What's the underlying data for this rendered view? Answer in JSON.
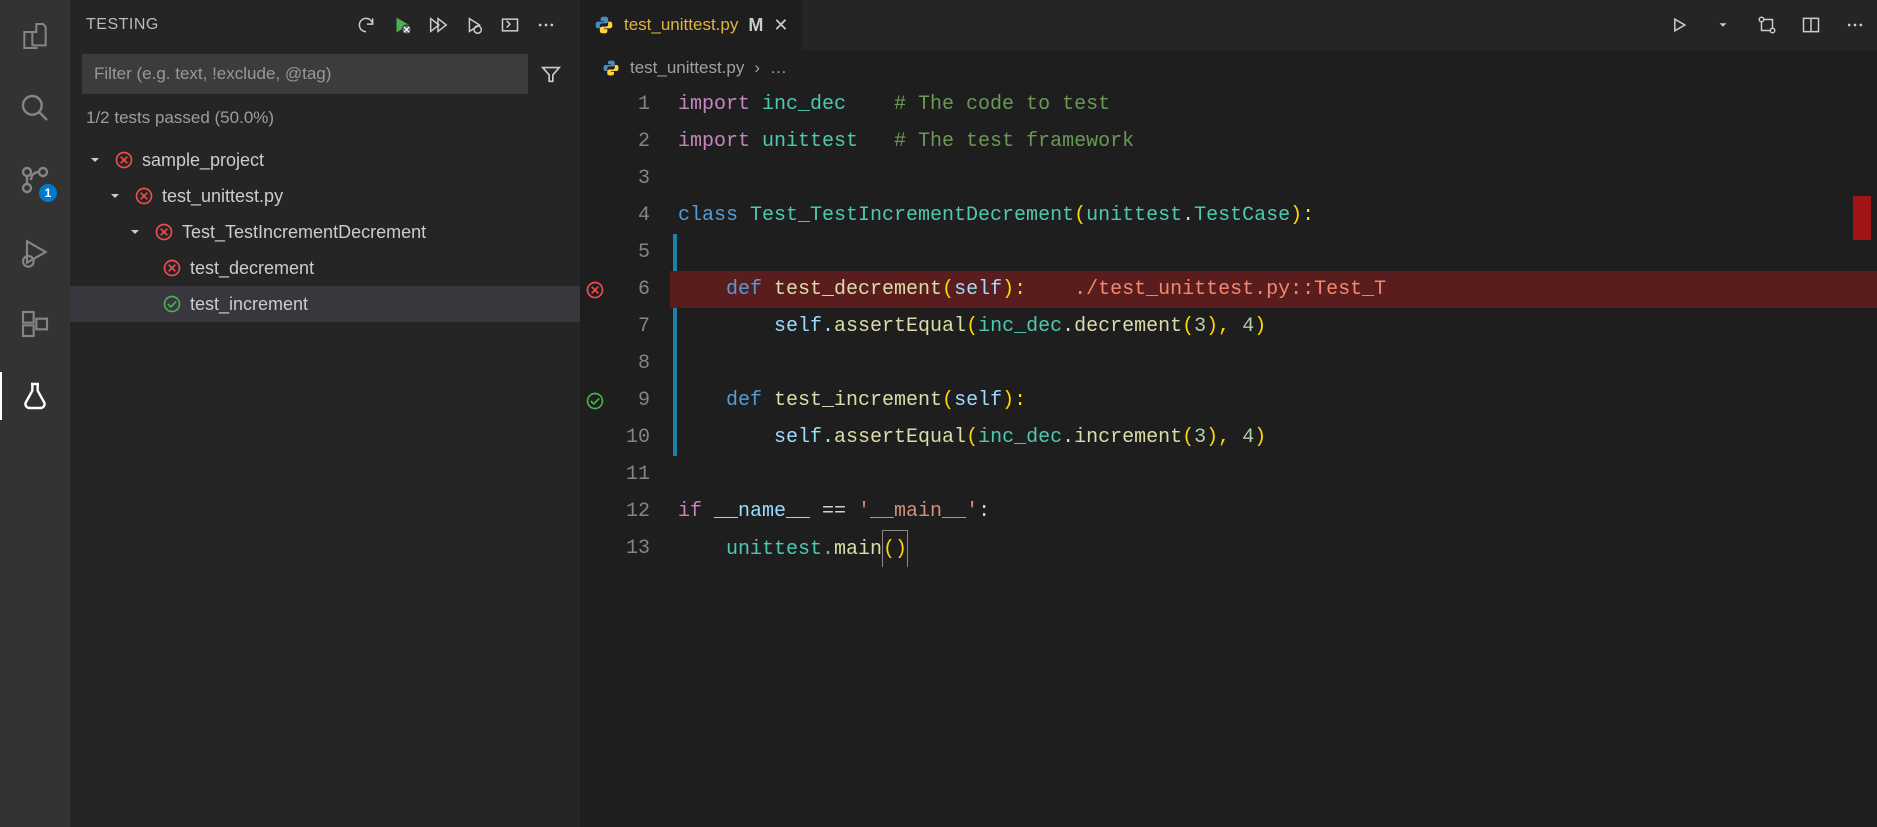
{
  "activitybar": {
    "source_control_badge": "1"
  },
  "sidebar": {
    "title": "TESTING",
    "filter_placeholder": "Filter (e.g. text, !exclude, @tag)",
    "status": "1/2 tests passed (50.0%)"
  },
  "tree": {
    "project": "sample_project",
    "file": "test_unittest.py",
    "class": "Test_TestIncrementDecrement",
    "test_fail": "test_decrement",
    "test_pass": "test_increment"
  },
  "tab": {
    "icon": "python-icon",
    "name": "test_unittest.py",
    "modified": "M"
  },
  "breadcrumb": {
    "file": "test_unittest.py",
    "more": "…"
  },
  "code": {
    "lines": [
      "1",
      "2",
      "3",
      "4",
      "5",
      "6",
      "7",
      "8",
      "9",
      "10",
      "11",
      "12",
      "13"
    ],
    "l1_a": "import ",
    "l1_b": "inc_dec",
    "l1_c": "    # The code to test",
    "l2_a": "import ",
    "l2_b": "unittest",
    "l2_c": "   # The test framework",
    "l4_a": "class ",
    "l4_b": "Test_TestIncrementDecrement",
    "l4_c": "(",
    "l4_d": "unittest",
    "l4_e": ".",
    "l4_f": "TestCase",
    "l4_g": "):",
    "l6_a": "    def ",
    "l6_b": "test_decrement",
    "l6_c": "(",
    "l6_d": "self",
    "l6_e": "):",
    "l6_inlay": "    ./test_unittest.py::Test_T",
    "l7_a": "        self.",
    "l7_b": "assertEqual",
    "l7_c": "(",
    "l7_d": "inc_dec",
    "l7_e": ".",
    "l7_f": "decrement",
    "l7_g": "(",
    "l7_h": "3",
    "l7_i": "), ",
    "l7_j": "4",
    "l7_k": ")",
    "l9_a": "    def ",
    "l9_b": "test_increment",
    "l9_c": "(",
    "l9_d": "self",
    "l9_e": "):",
    "l10_a": "        self.",
    "l10_b": "assertEqual",
    "l10_c": "(",
    "l10_d": "inc_dec",
    "l10_e": ".",
    "l10_f": "increment",
    "l10_g": "(",
    "l10_h": "3",
    "l10_i": "), ",
    "l10_j": "4",
    "l10_k": ")",
    "l12_a": "if ",
    "l12_b": "__name__",
    "l12_c": " == ",
    "l12_d": "'__main__'",
    "l12_e": ":",
    "l13_a": "    unittest.",
    "l13_b": "main",
    "l13_c": "()"
  }
}
